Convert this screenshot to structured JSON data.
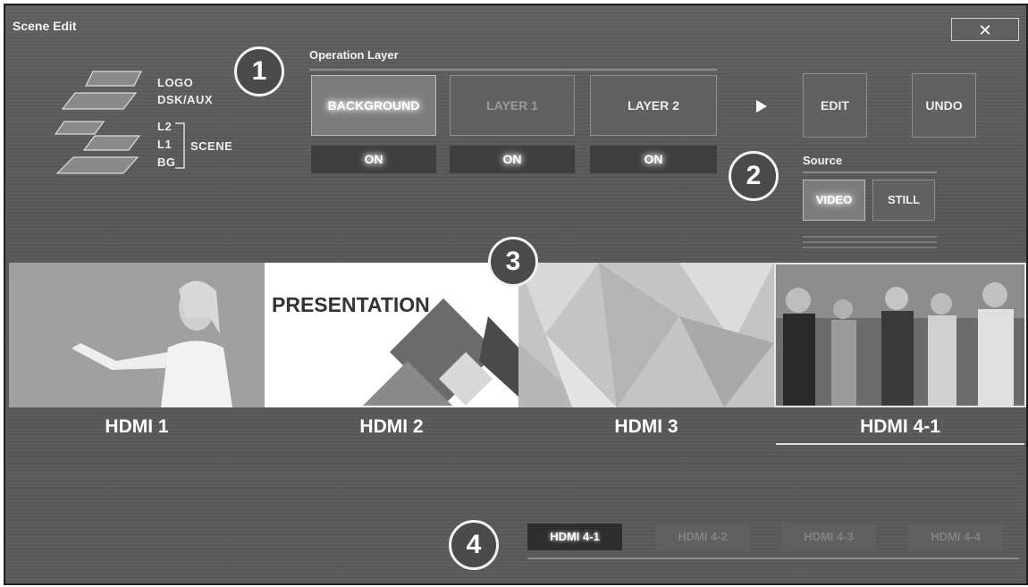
{
  "window": {
    "title": "Scene Edit",
    "close_glyph": "✕"
  },
  "diagram_labels": {
    "logo": "LOGO",
    "dsk_aux": "DSK/AUX",
    "l2": "L2",
    "l1": "L1",
    "scene": "SCENE",
    "bg": "BG"
  },
  "markers": [
    "1",
    "2",
    "3",
    "4"
  ],
  "operation_layer": {
    "heading": "Operation Layer",
    "layers": [
      {
        "label": "BACKGROUND",
        "state": "ON",
        "selected": true
      },
      {
        "label": "LAYER 1",
        "state": "ON",
        "selected": false
      },
      {
        "label": "LAYER 2",
        "state": "ON",
        "selected": false
      }
    ]
  },
  "actions": {
    "edit": "EDIT",
    "undo": "UNDO",
    "play_icon": "play-icon"
  },
  "source": {
    "heading": "Source",
    "options": [
      "VIDEO",
      "STILL"
    ],
    "selected": "VIDEO"
  },
  "inputs": [
    {
      "label": "HDMI 1",
      "thumb": "presenter-woman"
    },
    {
      "label": "HDMI 2",
      "thumb": "presentation-slide",
      "slide_text": "PRESENTATION"
    },
    {
      "label": "HDMI 3",
      "thumb": "polygon-pattern"
    },
    {
      "label": "HDMI 4-1",
      "thumb": "audience-clapping",
      "selected": true
    }
  ],
  "sub_inputs": [
    {
      "label": "HDMI 4-1",
      "selected": true
    },
    {
      "label": "HDMI 4-2",
      "selected": false
    },
    {
      "label": "HDMI 4-3",
      "selected": false
    },
    {
      "label": "HDMI 4-4",
      "selected": false
    }
  ]
}
